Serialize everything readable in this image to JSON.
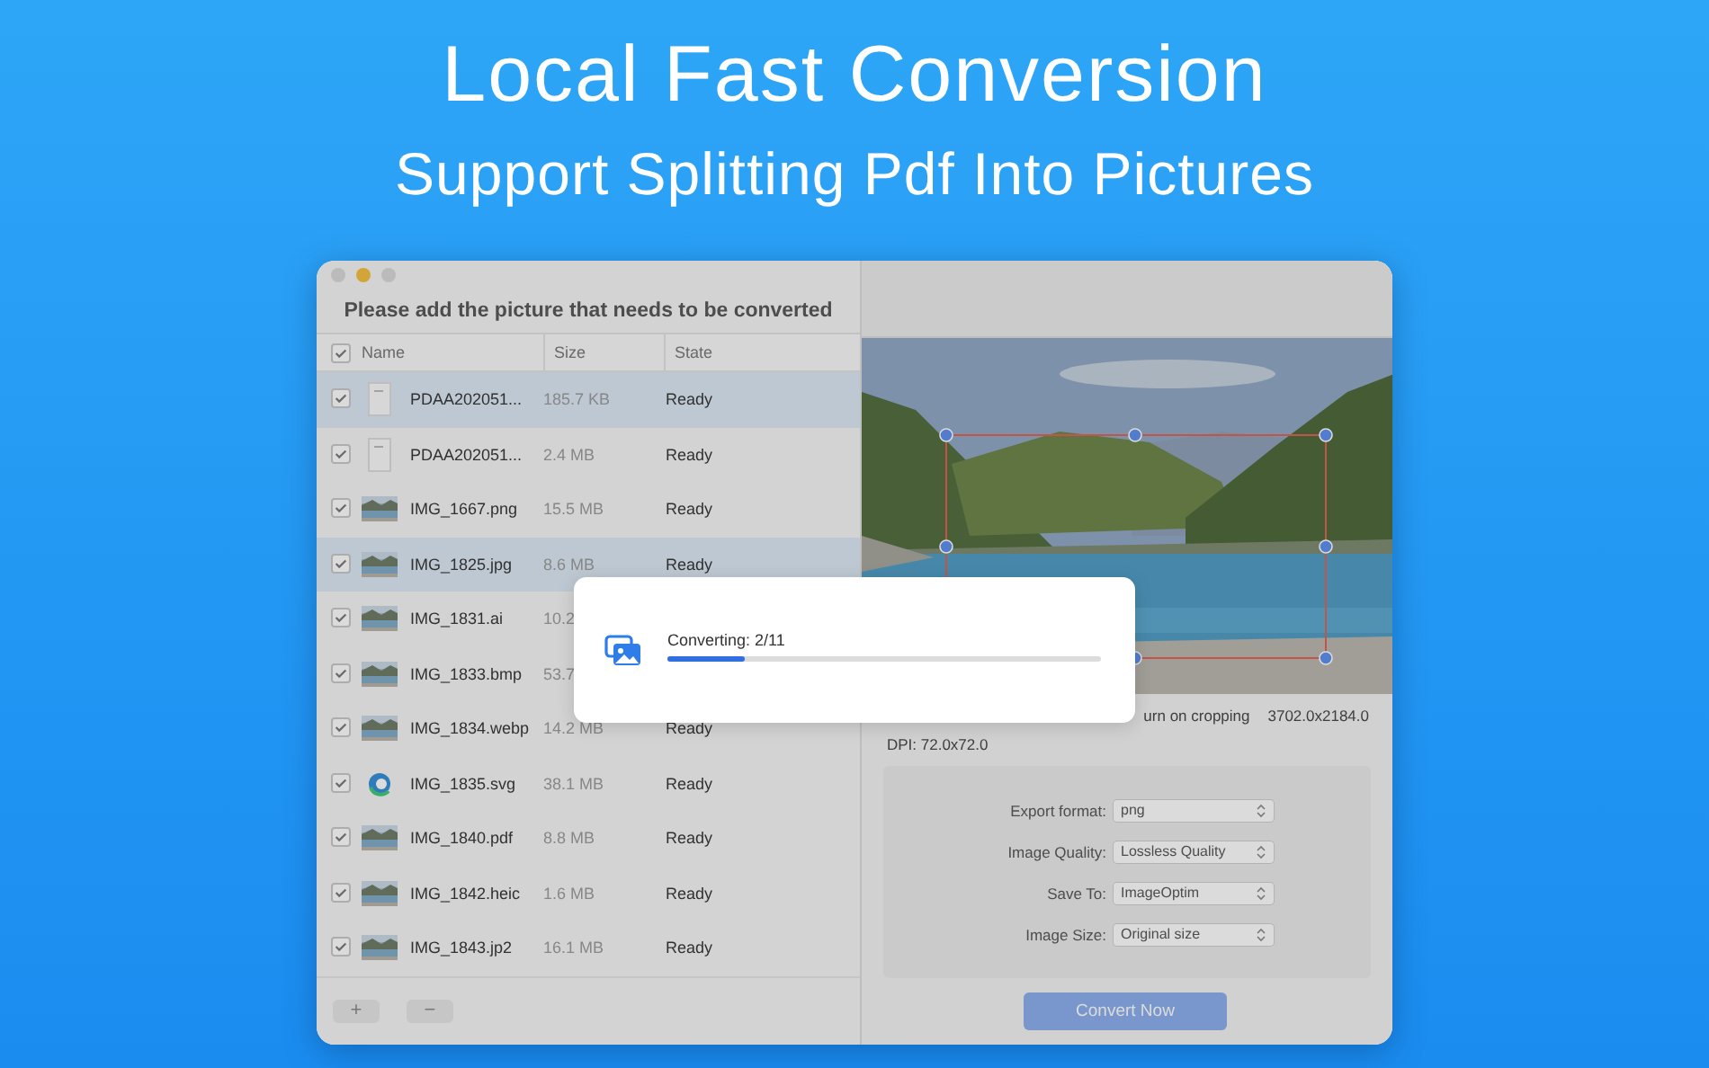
{
  "hero": {
    "title": "Local Fast Conversion",
    "subtitle": "Support Splitting Pdf Into Pictures"
  },
  "window": {
    "heading": "Please add the picture that needs to be converted"
  },
  "file_table": {
    "all_checked": true,
    "columns": [
      "Name",
      "Size",
      "State"
    ],
    "rows": [
      {
        "kind": "document",
        "name": "PDAA202051...",
        "size": "185.7 KB",
        "state": "Ready",
        "checked": true,
        "selected": true
      },
      {
        "kind": "document",
        "name": "PDAA202051...",
        "size": "2.4 MB",
        "state": "Ready",
        "checked": true,
        "selected": false
      },
      {
        "name": "IMG_1667.png",
        "size": "15.5 MB",
        "state": "Ready",
        "checked": true,
        "selected": false
      },
      {
        "name": "IMG_1825.jpg",
        "size": "8.6 MB",
        "state": "Ready",
        "checked": true,
        "selected": true
      },
      {
        "name": "IMG_1831.ai",
        "size": "10.2",
        "checked": true,
        "selected": false
      },
      {
        "name": "IMG_1833.bmp",
        "size": "53.7",
        "checked": true,
        "selected": false
      },
      {
        "name": "IMG_1834.webp",
        "size": "14.2 MB",
        "state": "Ready",
        "checked": true,
        "selected": false
      },
      {
        "kind": "emblem",
        "name": "IMG_1835.svg",
        "size": "38.1 MB",
        "state": "Ready",
        "checked": true,
        "selected": false
      },
      {
        "name": "IMG_1840.pdf",
        "size": "8.8 MB",
        "state": "Ready",
        "checked": true,
        "selected": false
      },
      {
        "name": "IMG_1842.heic",
        "size": "1.6 MB",
        "state": "Ready",
        "checked": true,
        "selected": false
      },
      {
        "name": "IMG_1843.jp2",
        "size": "16.1 MB",
        "state": "Ready",
        "checked": true,
        "selected": false
      }
    ]
  },
  "footer_buttons": [
    "+",
    "−"
  ],
  "preview": {
    "crop_label": "urn on cropping",
    "dimensions": "3702.0x2184.0",
    "dpi": "DPI: 72.0x72.0"
  },
  "settings": [
    {
      "label": "Export format:",
      "value": "png"
    },
    {
      "label": "Image Quality:",
      "value": "Lossless Quality"
    },
    {
      "label": "Save To:",
      "value": "ImageOptim"
    },
    {
      "label": "Image Size:",
      "value": "Original size"
    }
  ],
  "convert_button": "Convert Now",
  "dialog": {
    "message": "Converting: 2/11",
    "level": 0.18
  }
}
